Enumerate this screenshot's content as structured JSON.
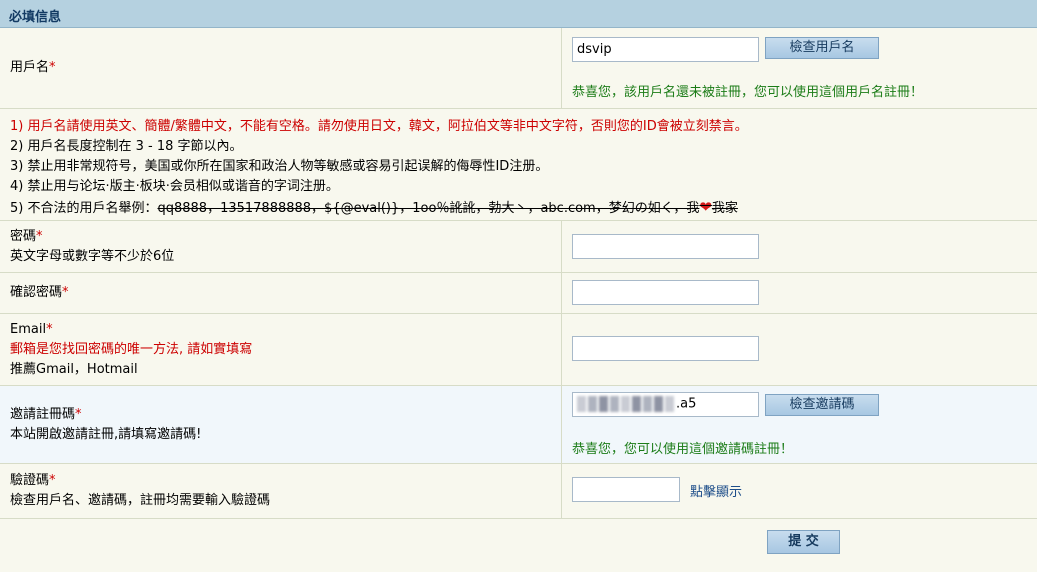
{
  "header": {
    "title": "必填信息"
  },
  "username": {
    "label": "用戶名",
    "required_mark": "*",
    "value": "dsvip",
    "check_button": "檢查用戶名",
    "status": "恭喜您，該用戶名還未被註冊，您可以使用這個用戶名註冊！"
  },
  "rules": {
    "r1": "1) 用戶名請使用英文、簡體/繁體中文，不能有空格。請勿使用日文，韓文，阿拉伯文等非中文字符，否則您的ID會被立刻禁言。",
    "r2": "2) 用戶名長度控制在 3 - 18 字節以內。",
    "r3": "3) 禁止用非常规符号，美国或你所在国家和政治人物等敏感或容易引起误解的侮辱性ID注册。",
    "r4": "4) 禁止用与论坛·版主·板块·会员相似或谐音的字词注册。",
    "r5_prefix": "5) 不合法的用戶名舉例：",
    "r5_examples": "qq8888，13517888888，${@eval()}，1oo％訛訛，勃大丶，abc.com，梦幻の如く，我",
    "r5_suffix": "我家",
    "heart_icon": "heart-icon"
  },
  "password": {
    "label": "密碼",
    "required_mark": "*",
    "hint": "英文字母或數字等不少於6位",
    "value": ""
  },
  "confirm_password": {
    "label": "確認密碼",
    "required_mark": "*",
    "value": ""
  },
  "email": {
    "label": "Email",
    "required_mark": "*",
    "hint_red": "郵箱是您找回密碼的唯一方法, 請如實填寫",
    "hint": "推薦Gmail，Hotmail",
    "value": ""
  },
  "invite": {
    "label": "邀請註冊碼",
    "required_mark": "*",
    "hint": "本站開啟邀請註冊,請填寫邀請碼!",
    "value_visible_suffix": ".a5",
    "check_button": "檢查邀請碼",
    "status": "恭喜您，您可以使用這個邀請碼註冊！"
  },
  "captcha": {
    "label": "驗證碼",
    "required_mark": "*",
    "hint": "檢查用戶名、邀請碼，註冊均需要輸入驗證碼",
    "value": "",
    "show_link": "點擊顯示"
  },
  "submit": {
    "label": "提 交"
  }
}
